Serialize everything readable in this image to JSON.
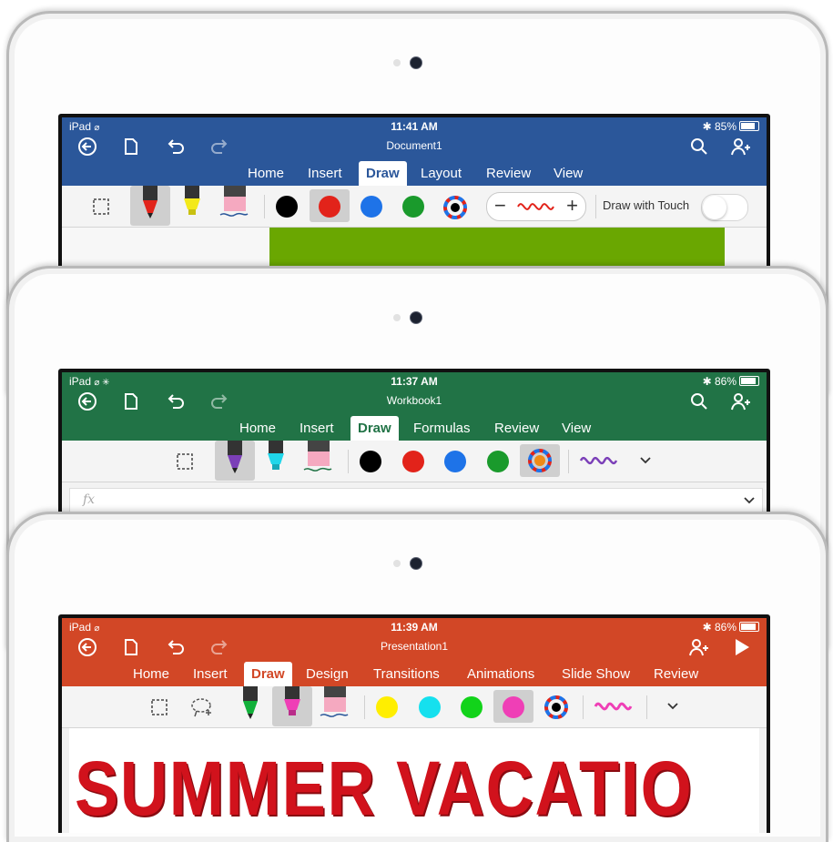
{
  "colors": {
    "word": "#2b579a",
    "excel": "#217346",
    "powerpoint": "#d24726"
  },
  "word": {
    "status": {
      "device": "iPad",
      "time": "11:41 AM",
      "battery": "85%"
    },
    "doc_title": "Document1",
    "icons_left": [
      "back-icon",
      "file-icon",
      "undo-icon",
      "redo-icon"
    ],
    "icons_right": [
      "search-icon",
      "share-icon"
    ],
    "tabs": [
      "Home",
      "Insert",
      "Draw",
      "Layout",
      "Review",
      "View"
    ],
    "active_tab": "Draw",
    "pens": [
      "pen-red",
      "highlighter-yellow",
      "eraser"
    ],
    "swatch_colors": [
      "#000000",
      "#e2231a",
      "#1e73e8",
      "#1a9a2c"
    ],
    "selected_swatch": 1,
    "thickness_minus": "−",
    "thickness_plus": "+",
    "draw_with_touch_label": "Draw with Touch"
  },
  "excel": {
    "status": {
      "device": "iPad",
      "time": "11:37 AM",
      "battery": "86%"
    },
    "doc_title": "Workbook1",
    "tabs": [
      "Home",
      "Insert",
      "Draw",
      "Formulas",
      "Review",
      "View"
    ],
    "active_tab": "Draw",
    "pens": [
      "pen-purple",
      "highlighter-cyan",
      "eraser"
    ],
    "swatch_colors": [
      "#000000",
      "#e2231a",
      "#1e73e8",
      "#1a9a2c"
    ],
    "fx_label": "fx"
  },
  "powerpoint": {
    "status": {
      "device": "iPad",
      "time": "11:39 AM",
      "battery": "86%"
    },
    "doc_title": "Presentation1",
    "tabs": [
      "Home",
      "Insert",
      "Draw",
      "Design",
      "Transitions",
      "Animations",
      "Slide Show",
      "Review"
    ],
    "active_tab": "Draw",
    "pens": [
      "pen-green",
      "highlighter-magenta",
      "eraser"
    ],
    "swatch_colors": [
      "#ffee00",
      "#15e0ee",
      "#12d31a",
      "#ef3fb6"
    ],
    "slide_title": "SUMMER VACATIO"
  }
}
